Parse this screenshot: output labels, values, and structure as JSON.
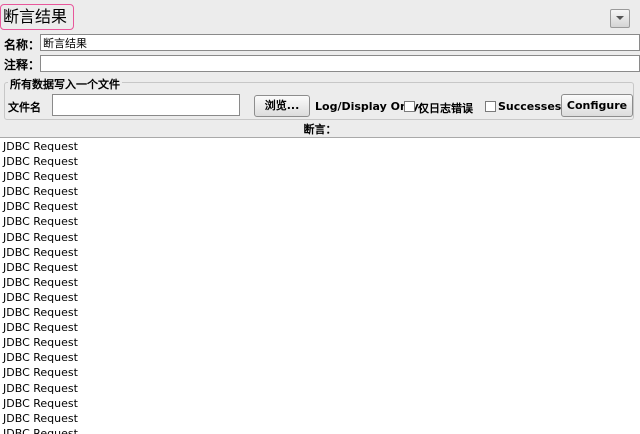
{
  "panel": {
    "title": "断言结果"
  },
  "form": {
    "name_label": "名称：",
    "name_value": "断言结果",
    "comment_label": "注释：",
    "comment_value": ""
  },
  "file_group": {
    "legend": "所有数据写入一个文件",
    "filename_label": "文件名",
    "filename_value": "",
    "browse_label": "浏览...",
    "log_display_label": "Log/Display Only:",
    "errors_only_label": "仅日志错误",
    "errors_only_checked": false,
    "successes_label": "Successes",
    "successes_checked": false,
    "configure_label": "Configure"
  },
  "results": {
    "header": "断言：",
    "items": [
      "JDBC Request",
      "JDBC Request",
      "JDBC Request",
      "JDBC Request",
      "JDBC Request",
      "JDBC Request",
      "JDBC Request",
      "JDBC Request",
      "JDBC Request",
      "JDBC Request",
      "JDBC Request",
      "JDBC Request",
      "JDBC Request",
      "JDBC Request",
      "JDBC Request",
      "JDBC Request",
      "JDBC Request",
      "JDBC Request",
      "JDBC Request",
      "JDBC Request"
    ]
  },
  "icons": {
    "dropdown": "chevron-down-icon"
  }
}
